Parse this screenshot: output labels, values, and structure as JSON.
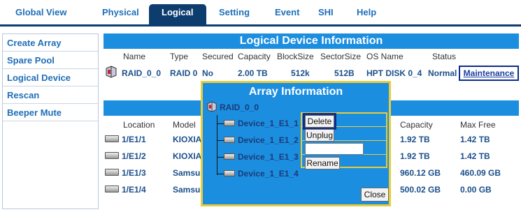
{
  "nav": {
    "tabs": [
      "Global View",
      "Physical",
      "Logical",
      "Setting",
      "Event",
      "SHI",
      "Help"
    ],
    "active": "Logical"
  },
  "sidebar": {
    "items": [
      "Create Array",
      "Spare Pool",
      "Logical Device",
      "Rescan",
      "Beeper Mute"
    ]
  },
  "logical": {
    "title": "Logical Device Information",
    "headers": [
      "Name",
      "Type",
      "Secured",
      "Capacity",
      "BlockSize",
      "SectorSize",
      "OS Name",
      "Status"
    ],
    "row": [
      "RAID_0_0",
      "RAID 0",
      "No",
      "2.00 TB",
      "512k",
      "512B",
      "HPT DISK 0_4",
      "Normal"
    ],
    "maintenance_link": "Maintenance"
  },
  "physical": {
    "headers": [
      "Location",
      "Model",
      "Capacity",
      "Max Free"
    ],
    "rows": [
      [
        "1/E1/1",
        "KIOXIA",
        "1.92 TB",
        "1.42 TB"
      ],
      [
        "1/E1/2",
        "KIOXIA",
        "1.92 TB",
        "1.42 TB"
      ],
      [
        "1/E1/3",
        "Samsur",
        "960.12 GB",
        "460.09 GB"
      ],
      [
        "1/E1/4",
        "Samsur",
        "500.02 GB",
        "0.00 GB"
      ]
    ]
  },
  "modal": {
    "title": "Array Information",
    "root": "RAID_0_0",
    "devices": [
      "Device_1_E1_1",
      "Device_1_E1_2",
      "Device_1_E1_3",
      "Device_1_E1_4"
    ],
    "buttons": {
      "delete": "Delete",
      "unplug": "Unplug",
      "rename": "Rename",
      "close": "Close"
    },
    "rename_value": ""
  },
  "colors": {
    "brand_dark": "#0d3d6e",
    "banner": "#1c8ee0",
    "link": "#1f6fb8",
    "highlight": "#e7cc3b"
  }
}
